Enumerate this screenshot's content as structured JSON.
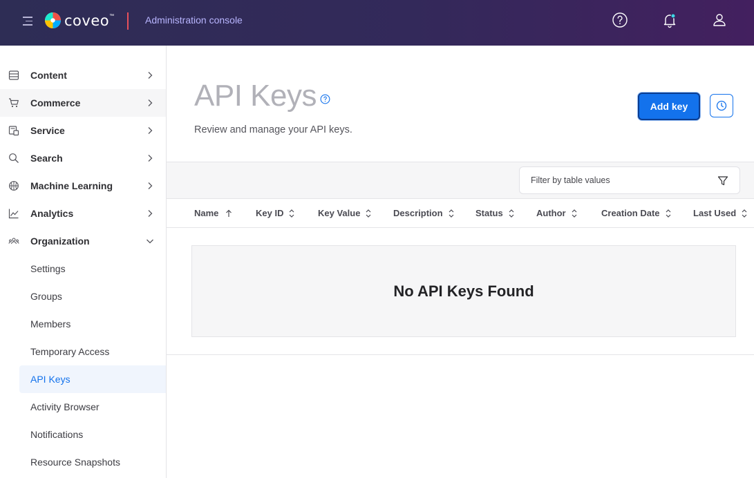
{
  "header": {
    "logo_text": "coveo",
    "logo_tm": "™",
    "console_title": "Administration console",
    "colors": {
      "accent_divider": "#e8505b",
      "console_title": "#b8b5ff"
    }
  },
  "sidebar": {
    "items": [
      {
        "label": "Content",
        "icon": "database-icon"
      },
      {
        "label": "Commerce",
        "icon": "cart-icon"
      },
      {
        "label": "Service",
        "icon": "service-icon"
      },
      {
        "label": "Search",
        "icon": "search-icon"
      },
      {
        "label": "Machine Learning",
        "icon": "brain-icon"
      },
      {
        "label": "Analytics",
        "icon": "chart-icon"
      },
      {
        "label": "Organization",
        "icon": "organization-icon"
      }
    ],
    "sub_items": [
      {
        "label": "Settings"
      },
      {
        "label": "Groups"
      },
      {
        "label": "Members"
      },
      {
        "label": "Temporary Access"
      },
      {
        "label": "API Keys",
        "active": true
      },
      {
        "label": "Activity Browser"
      },
      {
        "label": "Notifications"
      },
      {
        "label": "Resource Snapshots"
      }
    ]
  },
  "main": {
    "title": "API Keys",
    "description": "Review and manage your API keys.",
    "add_button_label": "Add key",
    "filter_placeholder": "Filter by table values",
    "columns": [
      {
        "label": "Name",
        "sort": "ascending"
      },
      {
        "label": "Key ID",
        "sort": "none"
      },
      {
        "label": "Key Value",
        "sort": "none"
      },
      {
        "label": "Description",
        "sort": "none"
      },
      {
        "label": "Status",
        "sort": "none"
      },
      {
        "label": "Author",
        "sort": "none"
      },
      {
        "label": "Creation Date",
        "sort": "none"
      },
      {
        "label": "Last Used",
        "sort": "none"
      }
    ],
    "empty_message": "No API Keys Found",
    "colors": {
      "primary": "#1372ec"
    }
  }
}
